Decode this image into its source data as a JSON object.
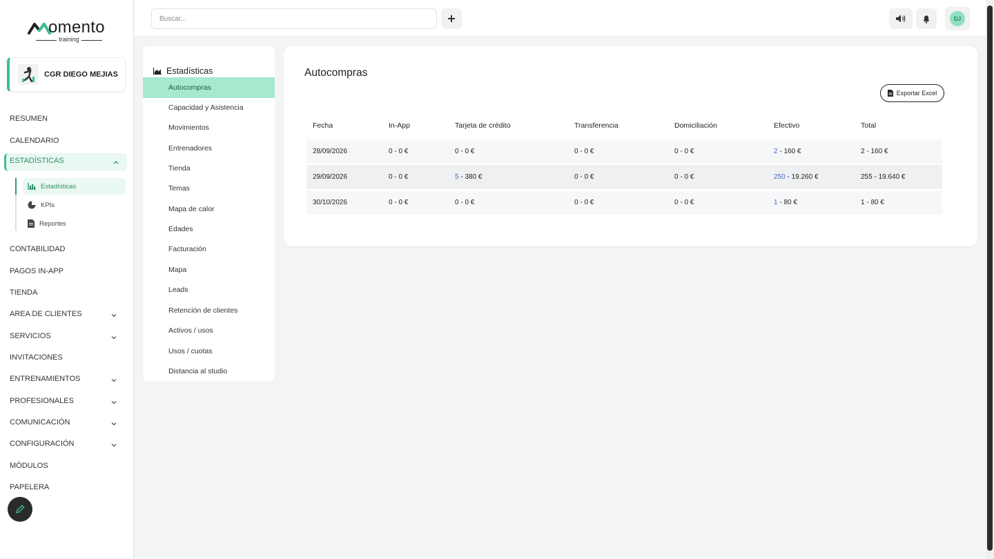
{
  "brand": {
    "name": "omento",
    "sub": "training"
  },
  "gym": {
    "name": "CGR DIEGO MEJIAS"
  },
  "sidebar": {
    "items": [
      {
        "label": "RESUMEN"
      },
      {
        "label": "CALENDARIO"
      },
      {
        "label": "ESTADÍSTICAS"
      },
      {
        "label": "CONTABILIDAD"
      },
      {
        "label": "PAGOS IN-APP"
      },
      {
        "label": "TIENDA"
      },
      {
        "label": "AREA DE CLIENTES"
      },
      {
        "label": "SERVICIOS"
      },
      {
        "label": "INVITACIONES"
      },
      {
        "label": "ENTRENAMIENTOS"
      },
      {
        "label": "PROFESIONALES"
      },
      {
        "label": "COMUNICACIÓN"
      },
      {
        "label": "CONFIGURACIÓN"
      },
      {
        "label": "MÓDULOS"
      },
      {
        "label": "PAPELERA"
      }
    ],
    "subitems": [
      {
        "label": "Estadísticas",
        "icon": "bar-chart-icon"
      },
      {
        "label": "KPIs",
        "icon": "pie-chart-icon"
      },
      {
        "label": "Reportes",
        "icon": "document-icon"
      }
    ]
  },
  "topbar": {
    "search_placeholder": "Buscar...",
    "avatar_initials": "DJ"
  },
  "stats_menu": {
    "title": "Estadísticas",
    "items": [
      {
        "label": "Autocompras"
      },
      {
        "label": "Capacidad y Asistencia"
      },
      {
        "label": "Movimientos"
      },
      {
        "label": "Entrenadores"
      },
      {
        "label": "Tienda"
      },
      {
        "label": "Temas"
      },
      {
        "label": "Mapa de calor"
      },
      {
        "label": "Edades"
      },
      {
        "label": "Facturación"
      },
      {
        "label": "Mapa"
      },
      {
        "label": "Leads"
      },
      {
        "label": "Retención de clientes"
      },
      {
        "label": "Activos / usos"
      },
      {
        "label": "Usos / cuotas"
      },
      {
        "label": "Distancia al studio"
      }
    ]
  },
  "main": {
    "title": "Autocompras",
    "export_label": "Exportar Excel",
    "table": {
      "headers": [
        "Fecha",
        "In-App",
        "Tarjeta de crédito",
        "Transferencia",
        "Domiciliación",
        "Efectivo",
        "Total"
      ],
      "rows": [
        {
          "fecha": "28/09/2026",
          "inapp": "0 - 0 €",
          "tarjeta_count": "",
          "tarjeta": "0 - 0 €",
          "transferencia": "0 - 0 €",
          "domiciliacion": "0 - 0 €",
          "efectivo_count": "2",
          "efectivo": " - 160 €",
          "total": "2 - 160 €"
        },
        {
          "fecha": "29/09/2026",
          "inapp": "0 - 0 €",
          "tarjeta_count": "5",
          "tarjeta": " - 380 €",
          "transferencia": "0 - 0 €",
          "domiciliacion": "0 - 0 €",
          "efectivo_count": "250",
          "efectivo": " - 19.260 €",
          "total": "255 - 19.640 €"
        },
        {
          "fecha": "30/10/2026",
          "inapp": "0 - 0 €",
          "tarjeta_count": "",
          "tarjeta": "0 - 0 €",
          "transferencia": "0 - 0 €",
          "domiciliacion": "0 - 0 €",
          "efectivo_count": "1",
          "efectivo": " - 80 €",
          "total": "1 - 80 €"
        }
      ]
    }
  },
  "colors": {
    "accent": "#3dbf8d",
    "accent_light": "#a6e9cd",
    "link": "#4a66c9"
  }
}
